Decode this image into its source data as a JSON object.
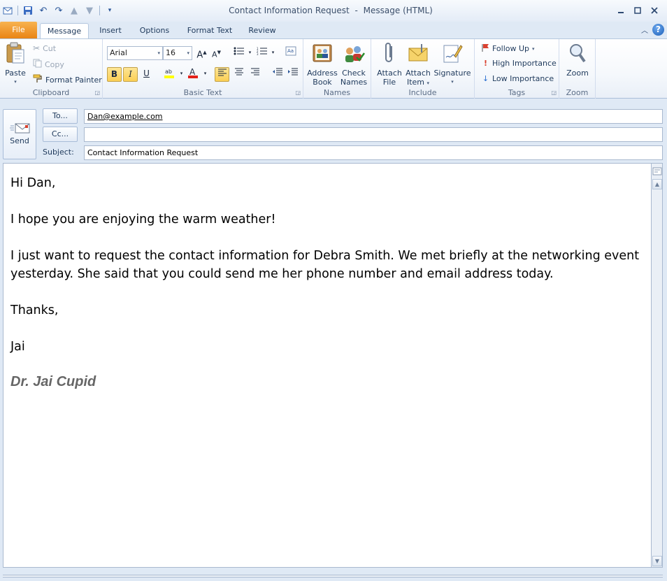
{
  "window": {
    "title": "Contact Information Request",
    "title_separator": "-",
    "mode": "Message (HTML)"
  },
  "tabs": [
    {
      "label": "File"
    },
    {
      "label": "Message"
    },
    {
      "label": "Insert"
    },
    {
      "label": "Options"
    },
    {
      "label": "Format Text"
    },
    {
      "label": "Review"
    }
  ],
  "ribbon": {
    "clipboard": {
      "label": "Clipboard",
      "paste": "Paste",
      "cut": "Cut",
      "copy": "Copy",
      "format_painter": "Format Painter"
    },
    "basic_text": {
      "label": "Basic Text",
      "font": "Arial",
      "size": "16",
      "bold": "B",
      "italic": "I",
      "underline": "U"
    },
    "names": {
      "label": "Names",
      "address_book_1": "Address",
      "address_book_2": "Book",
      "check_names_1": "Check",
      "check_names_2": "Names"
    },
    "include": {
      "label": "Include",
      "attach_file_1": "Attach",
      "attach_file_2": "File",
      "attach_item_1": "Attach",
      "attach_item_2": "Item",
      "signature": "Signature"
    },
    "tags": {
      "label": "Tags",
      "follow_up": "Follow Up",
      "high_importance": "High Importance",
      "low_importance": "Low Importance"
    },
    "zoom": {
      "label": "Zoom",
      "zoom": "Zoom"
    }
  },
  "compose": {
    "send_label": "Send",
    "to_label": "To...",
    "cc_label": "Cc...",
    "subject_label": "Subject:",
    "to_value": "Dan@example.com",
    "cc_value": "",
    "subject_value": "Contact Information Request"
  },
  "body": {
    "greeting": "Hi Dan,",
    "para1": "I hope you are enjoying the warm weather!",
    "para2_line1": "I just want to request the contact information for Debra Smith.  We met briefly at the networking event",
    "para2_line2": "yesterday.  She said that you could send me her phone number and email address today.",
    "closing": "Thanks,",
    "name": "Jai",
    "signature": "Dr. Jai Cupid"
  },
  "colors": {
    "file_tab": "#e98414",
    "accent": "#1e395b",
    "signature": "#666666"
  }
}
